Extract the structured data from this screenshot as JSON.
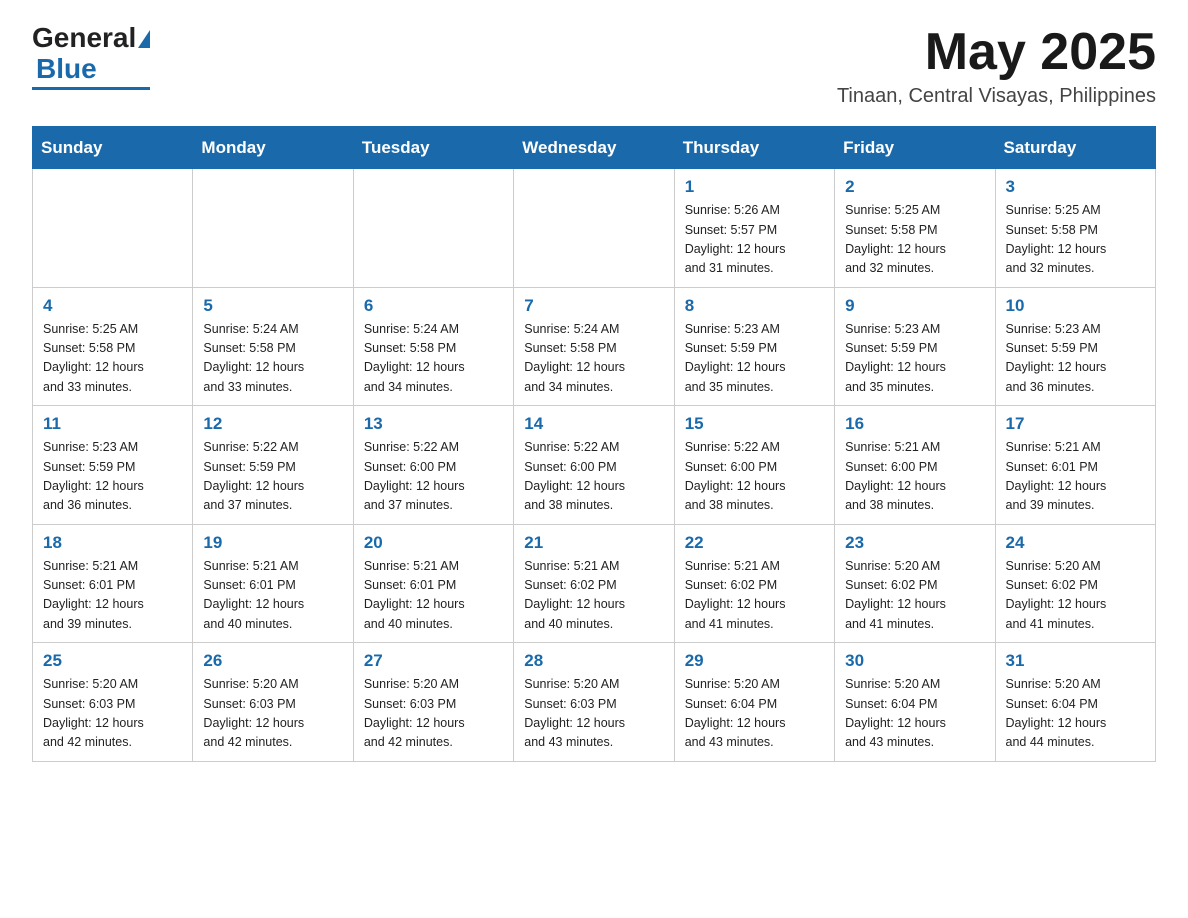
{
  "header": {
    "logo_general": "General",
    "logo_blue": "Blue",
    "month": "May 2025",
    "location": "Tinaan, Central Visayas, Philippines"
  },
  "weekdays": [
    "Sunday",
    "Monday",
    "Tuesday",
    "Wednesday",
    "Thursday",
    "Friday",
    "Saturday"
  ],
  "weeks": [
    [
      {
        "day": "",
        "info": ""
      },
      {
        "day": "",
        "info": ""
      },
      {
        "day": "",
        "info": ""
      },
      {
        "day": "",
        "info": ""
      },
      {
        "day": "1",
        "info": "Sunrise: 5:26 AM\nSunset: 5:57 PM\nDaylight: 12 hours\nand 31 minutes."
      },
      {
        "day": "2",
        "info": "Sunrise: 5:25 AM\nSunset: 5:58 PM\nDaylight: 12 hours\nand 32 minutes."
      },
      {
        "day": "3",
        "info": "Sunrise: 5:25 AM\nSunset: 5:58 PM\nDaylight: 12 hours\nand 32 minutes."
      }
    ],
    [
      {
        "day": "4",
        "info": "Sunrise: 5:25 AM\nSunset: 5:58 PM\nDaylight: 12 hours\nand 33 minutes."
      },
      {
        "day": "5",
        "info": "Sunrise: 5:24 AM\nSunset: 5:58 PM\nDaylight: 12 hours\nand 33 minutes."
      },
      {
        "day": "6",
        "info": "Sunrise: 5:24 AM\nSunset: 5:58 PM\nDaylight: 12 hours\nand 34 minutes."
      },
      {
        "day": "7",
        "info": "Sunrise: 5:24 AM\nSunset: 5:58 PM\nDaylight: 12 hours\nand 34 minutes."
      },
      {
        "day": "8",
        "info": "Sunrise: 5:23 AM\nSunset: 5:59 PM\nDaylight: 12 hours\nand 35 minutes."
      },
      {
        "day": "9",
        "info": "Sunrise: 5:23 AM\nSunset: 5:59 PM\nDaylight: 12 hours\nand 35 minutes."
      },
      {
        "day": "10",
        "info": "Sunrise: 5:23 AM\nSunset: 5:59 PM\nDaylight: 12 hours\nand 36 minutes."
      }
    ],
    [
      {
        "day": "11",
        "info": "Sunrise: 5:23 AM\nSunset: 5:59 PM\nDaylight: 12 hours\nand 36 minutes."
      },
      {
        "day": "12",
        "info": "Sunrise: 5:22 AM\nSunset: 5:59 PM\nDaylight: 12 hours\nand 37 minutes."
      },
      {
        "day": "13",
        "info": "Sunrise: 5:22 AM\nSunset: 6:00 PM\nDaylight: 12 hours\nand 37 minutes."
      },
      {
        "day": "14",
        "info": "Sunrise: 5:22 AM\nSunset: 6:00 PM\nDaylight: 12 hours\nand 38 minutes."
      },
      {
        "day": "15",
        "info": "Sunrise: 5:22 AM\nSunset: 6:00 PM\nDaylight: 12 hours\nand 38 minutes."
      },
      {
        "day": "16",
        "info": "Sunrise: 5:21 AM\nSunset: 6:00 PM\nDaylight: 12 hours\nand 38 minutes."
      },
      {
        "day": "17",
        "info": "Sunrise: 5:21 AM\nSunset: 6:01 PM\nDaylight: 12 hours\nand 39 minutes."
      }
    ],
    [
      {
        "day": "18",
        "info": "Sunrise: 5:21 AM\nSunset: 6:01 PM\nDaylight: 12 hours\nand 39 minutes."
      },
      {
        "day": "19",
        "info": "Sunrise: 5:21 AM\nSunset: 6:01 PM\nDaylight: 12 hours\nand 40 minutes."
      },
      {
        "day": "20",
        "info": "Sunrise: 5:21 AM\nSunset: 6:01 PM\nDaylight: 12 hours\nand 40 minutes."
      },
      {
        "day": "21",
        "info": "Sunrise: 5:21 AM\nSunset: 6:02 PM\nDaylight: 12 hours\nand 40 minutes."
      },
      {
        "day": "22",
        "info": "Sunrise: 5:21 AM\nSunset: 6:02 PM\nDaylight: 12 hours\nand 41 minutes."
      },
      {
        "day": "23",
        "info": "Sunrise: 5:20 AM\nSunset: 6:02 PM\nDaylight: 12 hours\nand 41 minutes."
      },
      {
        "day": "24",
        "info": "Sunrise: 5:20 AM\nSunset: 6:02 PM\nDaylight: 12 hours\nand 41 minutes."
      }
    ],
    [
      {
        "day": "25",
        "info": "Sunrise: 5:20 AM\nSunset: 6:03 PM\nDaylight: 12 hours\nand 42 minutes."
      },
      {
        "day": "26",
        "info": "Sunrise: 5:20 AM\nSunset: 6:03 PM\nDaylight: 12 hours\nand 42 minutes."
      },
      {
        "day": "27",
        "info": "Sunrise: 5:20 AM\nSunset: 6:03 PM\nDaylight: 12 hours\nand 42 minutes."
      },
      {
        "day": "28",
        "info": "Sunrise: 5:20 AM\nSunset: 6:03 PM\nDaylight: 12 hours\nand 43 minutes."
      },
      {
        "day": "29",
        "info": "Sunrise: 5:20 AM\nSunset: 6:04 PM\nDaylight: 12 hours\nand 43 minutes."
      },
      {
        "day": "30",
        "info": "Sunrise: 5:20 AM\nSunset: 6:04 PM\nDaylight: 12 hours\nand 43 minutes."
      },
      {
        "day": "31",
        "info": "Sunrise: 5:20 AM\nSunset: 6:04 PM\nDaylight: 12 hours\nand 44 minutes."
      }
    ]
  ]
}
